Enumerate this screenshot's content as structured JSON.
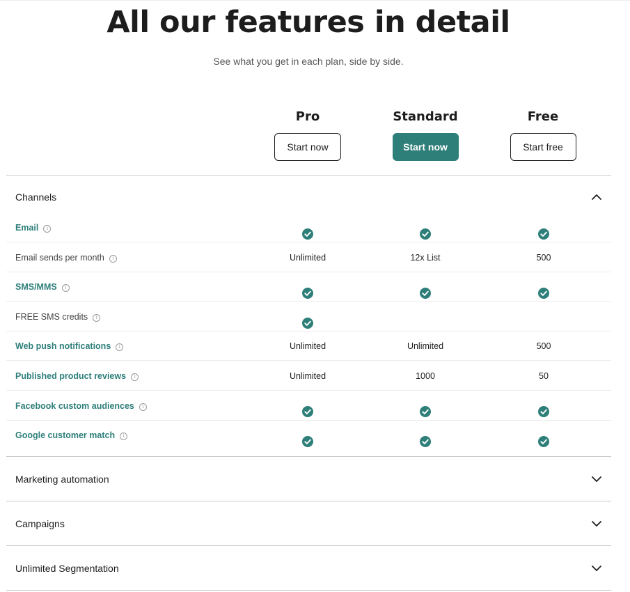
{
  "header": {
    "title": "All our features in detail",
    "subtitle": "See what you get in each plan, side by side."
  },
  "plans": [
    {
      "name": "Pro",
      "button_label": "Start now",
      "style": "outline"
    },
    {
      "name": "Standard",
      "button_label": "Start now",
      "style": "primary"
    },
    {
      "name": "Free",
      "button_label": "Start free",
      "style": "outline"
    }
  ],
  "colors": {
    "accent": "#2e7f7a",
    "text": "#1d1d1d",
    "divider": "#c8c8c8"
  },
  "icons": {
    "check": "check-circle-icon",
    "info": "info-icon",
    "chevron_up": "chevron-up-icon",
    "chevron_down": "chevron-down-icon",
    "info_glyph": "i"
  },
  "sections": [
    {
      "title": "Channels",
      "expanded": true,
      "rows": [
        {
          "label": "Email",
          "link": true,
          "values": [
            "check",
            "check",
            "check"
          ]
        },
        {
          "label": "Email sends per month",
          "link": false,
          "values": [
            "Unlimited",
            "12x List",
            "500"
          ]
        },
        {
          "label": "SMS/MMS",
          "link": true,
          "values": [
            "check",
            "check",
            "check"
          ]
        },
        {
          "label": "FREE SMS credits",
          "link": false,
          "values": [
            "check",
            "",
            ""
          ]
        },
        {
          "label": "Web push notifications",
          "link": true,
          "values": [
            "Unlimited",
            "Unlimited",
            "500"
          ]
        },
        {
          "label": "Published product reviews",
          "link": true,
          "values": [
            "Unlimited",
            "1000",
            "50"
          ]
        },
        {
          "label": "Facebook custom audiences",
          "link": true,
          "values": [
            "check",
            "check",
            "check"
          ]
        },
        {
          "label": "Google customer match",
          "link": true,
          "values": [
            "check",
            "check",
            "check"
          ]
        }
      ]
    },
    {
      "title": "Marketing automation",
      "expanded": false
    },
    {
      "title": "Campaigns",
      "expanded": false
    },
    {
      "title": "Unlimited Segmentation",
      "expanded": false
    }
  ]
}
